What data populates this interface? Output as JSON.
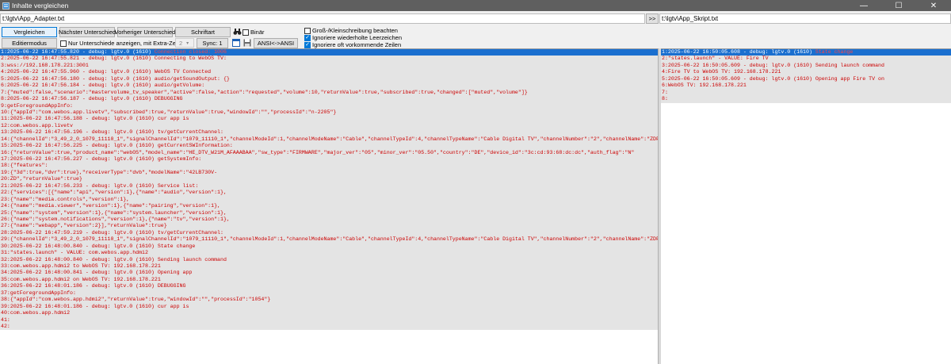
{
  "window": {
    "title": "Inhalte vergleichen",
    "minimize": "—",
    "maximize": "☐",
    "close": "✕"
  },
  "paths": {
    "left": "t:\\lgtv\\App_Adapter.txt",
    "swap": ">>",
    "right": "t:\\lgtv\\App_Skript.txt"
  },
  "toolbar": {
    "compare": "Vergleichen",
    "next_diff": "Nächster Unterschied",
    "prev_diff": "Vorheriger Unterschied",
    "font": "Schriftart",
    "binary": "Binär",
    "edit_mode": "Editiermodus",
    "only_diffs": "Nur Unterschiede anzeigen, mit Extra-Zeilen:",
    "extra_lines": "2",
    "sync": "Sync: 1",
    "ansi": "ANSI<->ANSI",
    "case": "Groß-/Kleinschreibung beachten",
    "ignore_spaces": "Ignoriere wiederholte Leerzeichen",
    "ignore_frequent": "Ignoriere oft vorkommende Zeilen"
  },
  "left_lines": [
    {
      "text": "1:2025-06-22 16:47:55.820 - debug: lgtv.0 (1610) ",
      "hl": "Connection closed: 1006",
      "selected": true
    },
    {
      "text": "2:2025-06-22 16:47:55.821 - debug: lgtv.0 (1610) Connecting to WebOS TV:"
    },
    {
      "text": "3:wss://192.168.178.221:3001"
    },
    {
      "text": "4:2025-06-22 16:47:55.960 - debug: lgtv.0 (1610) WebOS TV Connected"
    },
    {
      "text": "5:2025-06-22 16:47:56.180 - debug: lgtv.0 (1610) audio/getSoundOutput: {}"
    },
    {
      "text": "6:2025-06-22 16:47:56.184 - debug: lgtv.0 (1610) audio/getVolume:"
    },
    {
      "text": "7:{\"muted\":false,\"scenario\":\"mastervolume_tv_speaker\",\"active\":false,\"action\":\"requested\",\"volume\":10,\"returnValue\":true,\"subscribed\":true,\"changed\":[\"muted\",\"volume\"]}"
    },
    {
      "text": "8:2025-06-22 16:47:56.187 - debug: lgtv.0 (1610) DEBUGGING"
    },
    {
      "text": "9:getForegroundAppInfo:"
    },
    {
      "text": "10:{\"appId\":\"com.webos.app.livetv\",\"subscribed\":true,\"returnValue\":true,\"windowId\":\"\",\"processId\":\"n-2205\"}"
    },
    {
      "text": "11:2025-06-22 16:47:56.188 - debug: lgtv.0 (1610) cur app is"
    },
    {
      "text": "12:com.webos.app.livetv"
    },
    {
      "text": "13:2025-06-22 16:47:56.196 - debug: lgtv.0 (1610) tv/getCurrentChannel:"
    },
    {
      "text": "14:{\"channelId\":\"3_49_2_0_1079_11110_1\",\"signalChannelId\":\"1079_11110_1\",\"channelModeId\":1,\"channelModeName\":\"Cable\",\"channelTypeId\":4,\"channelTypeName\":\"Cable Digital TV\",\"channelNumber\":\"2\",\"channelName\":\"ZDF HD\""
    },
    {
      "text": "15:2025-06-22 16:47:56.225 - debug: lgtv.0 (1610) getCurrentSWInformation:"
    },
    {
      "text": "16:{\"returnValue\":true,\"product_name\":\"webOS\",\"model_name\":\"HE_DTV_W21M_AFAAABAA\",\"sw_type\":\"FIRMWARE\",\"major_ver\":\"05\",\"minor_ver\":\"05.50\",\"country\":\"DE\",\"device_id\":\"3c:cd:93:68:dc:dc\",\"auth_flag\":\"N\""
    },
    {
      "text": "17:2025-06-22 16:47:56.227 - debug: lgtv.0 (1610) getSystemInfo:"
    },
    {
      "text": "18:{\"features\":"
    },
    {
      "text": "19:{\"3d\":true,\"dvr\":true},\"receiverType\":\"dvb\",\"modelName\":\"42LB730V-"
    },
    {
      "text": "20:ZD\",\"returnValue\":true}"
    },
    {
      "text": "21:2025-06-22 16:47:56.233 - debug: lgtv.0 (1610) Service list:"
    },
    {
      "text": "22:{\"services\":[{\"name\":\"api\",\"version\":1},{\"name\":\"audio\",\"version\":1},"
    },
    {
      "text": "23:{\"name\":\"media.controls\",\"version\":1},"
    },
    {
      "text": "24:{\"name\":\"media.viewer\",\"version\":1},{\"name\":\"pairing\",\"version\":1},"
    },
    {
      "text": "25:{\"name\":\"system\",\"version\":1},{\"name\":\"system.launcher\",\"version\":1},"
    },
    {
      "text": "26:{\"name\":\"system.notifications\",\"version\":1},{\"name\":\"tv\",\"version\":1},"
    },
    {
      "text": "27:{\"name\":\"webapp\",\"version\":2}],\"returnValue\":true}"
    },
    {
      "text": "28:2025-06-22 16:47:59.219 - debug: lgtv.0 (1610) tv/getCurrentChannel:"
    },
    {
      "text": "29:{\"channelId\":\"3_49_2_0_1079_11110_1\",\"signalChannelId\":\"1079_11110_1\",\"channelModeId\":1,\"channelModeName\":\"Cable\",\"channelTypeId\":4,\"channelTypeName\":\"Cable Digital TV\",\"channelNumber\":\"2\",\"channelName\":\"ZDF HD\""
    },
    {
      "text": "30:2025-06-22 16:48:00.840 - debug: lgtv.0 (1610) State change"
    },
    {
      "text": "31:\"states.launch\" - VALUE: com.webos.app.hdmi2"
    },
    {
      "text": "32:2025-06-22 16:48:00.840 - debug: lgtv.0 (1610) Sending launch command"
    },
    {
      "text": "33:com.webos.app.hdmi2 to WebOS TV: 192.168.178.221"
    },
    {
      "text": "34:2025-06-22 16:48:00.841 - debug: lgtv.0 (1610) Opening app"
    },
    {
      "text": "35:com.webos.app.hdmi2 on WebOS TV: 192.168.178.221"
    },
    {
      "text": "36:2025-06-22 16:48:01.186 - debug: lgtv.0 (1610) DEBUGGING"
    },
    {
      "text": "37:getForegroundAppInfo:"
    },
    {
      "text": "38:{\"appId\":\"com.webos.app.hdmi2\",\"returnValue\":true,\"windowId\":\"\",\"processId\":\"1054\"}"
    },
    {
      "text": "39:2025-06-22 16:48:01.186 - debug: lgtv.0 (1610) cur app is"
    },
    {
      "text": "40:com.webos.app.hdmi2"
    },
    {
      "text": "41:"
    },
    {
      "text": "42:"
    }
  ],
  "right_lines": [
    {
      "text": "1:2025-06-22 16:50:05.608 - debug: lgtv.0 (1610) ",
      "hl": "State change",
      "selected": true
    },
    {
      "text": "2:\"states.launch\" - VALUE: Fire TV"
    },
    {
      "text": "3:2025-06-22 16:50:05.609 - debug: lgtv.0 (1610) Sending launch command"
    },
    {
      "text": "4:Fire TV to WebOS TV: 192.168.178.221"
    },
    {
      "text": "5:2025-06-22 16:50:05.609 - debug: lgtv.0 (1610) Opening app Fire TV on"
    },
    {
      "text": "6:WebOS TV: 192.168.178.221"
    },
    {
      "text": "7:"
    },
    {
      "text": "8:"
    }
  ]
}
